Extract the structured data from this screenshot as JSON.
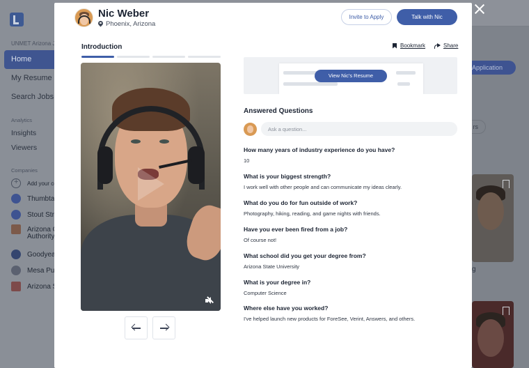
{
  "background": {
    "org_label": "UNMET Arizona Jo",
    "nav": [
      "Home",
      "My Resume",
      "Search Jobs"
    ],
    "analytics_label": "Analytics",
    "analytics_items": [
      "Insights",
      "Viewers"
    ],
    "companies_label": "Companies",
    "add_company": "Add your co",
    "companies": [
      "Thumbta",
      "Stout Str",
      "Arizona C",
      "Authority",
      "Goodyea",
      "Mesa Pu",
      "Arizona S"
    ],
    "apply_label": "Application",
    "pill_label": "rs",
    "card_caption": "g"
  },
  "candidate": {
    "name": "Nic Weber",
    "location": "Phoenix, Arizona"
  },
  "actions": {
    "invite": "Invite to Apply",
    "talk": "Talk with Nic",
    "bookmark": "Bookmark",
    "share": "Share",
    "view_resume": "View Nic's Resume"
  },
  "video": {
    "section_label": "Introduction",
    "segments_total": 4,
    "segment_active": 1
  },
  "questions": {
    "title": "Answered Questions",
    "ask_placeholder": "Ask a question...",
    "items": [
      {
        "q": "How many years of industry experience do you have?",
        "a": "10"
      },
      {
        "q": "What is your biggest strength?",
        "a": "I work well with other people and can communicate my ideas clearly."
      },
      {
        "q": "What do you do for fun outside of work?",
        "a": "Photography, hiking, reading, and game nights with friends."
      },
      {
        "q": "Have you ever been fired from a job?",
        "a": "Of course not!"
      },
      {
        "q": "What school did you get your degree from?",
        "a": "Arizona State University"
      },
      {
        "q": "What is your degree in?",
        "a": "Computer Science"
      },
      {
        "q": "Where else have you worked?",
        "a": "I've helped launch new products for ForeSee, Verint, Answers, and others."
      }
    ]
  },
  "colors": {
    "accent": "#3f5ea8",
    "overlay": "#7e838b"
  },
  "icons": [
    "close-icon",
    "pin-icon",
    "bookmark-icon",
    "share-icon",
    "mute-icon",
    "arrow-left-icon",
    "arrow-right-icon"
  ]
}
